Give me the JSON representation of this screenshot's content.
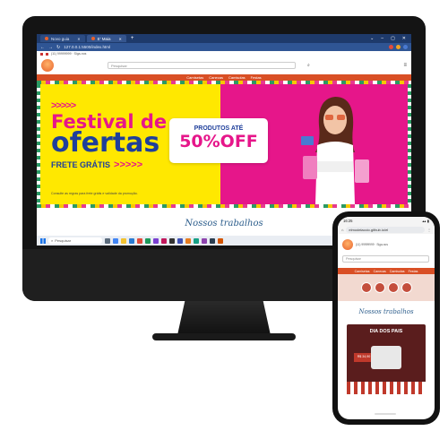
{
  "browser": {
    "tabs": [
      {
        "label": "Novo guia"
      },
      {
        "label": "E' Maia"
      }
    ],
    "new_tab": "+",
    "url": "127.0.0.1:5500/index.html"
  },
  "site": {
    "contact": "(11) 99999999 · Siga-nos",
    "search_placeholder": "Pesquisar",
    "nav": [
      "Camisetas",
      "Canecas",
      "Camisolas",
      "Festas"
    ],
    "banner": {
      "chevrons": ">>>>>",
      "line1": "Festival de",
      "line2": "ofertas",
      "line3": "FRETE GRÁTIS",
      "line3_arrows": ">>>>>",
      "promo_top": "PRODUTOS ATÉ",
      "promo_big": "50%OFF",
      "note": "Consulte as regras para frete grátis e validade da promoção."
    },
    "section_title": "Nossos trabalhos"
  },
  "taskbar": {
    "search_placeholder": "Pesquisar"
  },
  "phone": {
    "time": "16:25",
    "url": "elmodelaccio.github.io/el",
    "contact": "(11) 99999999 · Siga-nos",
    "search_placeholder": "Pesquisar",
    "nav": [
      "Camisetas",
      "Canecas",
      "Camisolas",
      "Festas"
    ],
    "section_title": "Nossos trabalhos",
    "card_title": "DIA DOS PAIS",
    "card_price": "R$ 34,90"
  },
  "colors": {
    "accent_orange": "#d94f25",
    "banner_yellow": "#ffe800",
    "banner_pink": "#e6168a",
    "banner_blue": "#1f3f9b"
  }
}
